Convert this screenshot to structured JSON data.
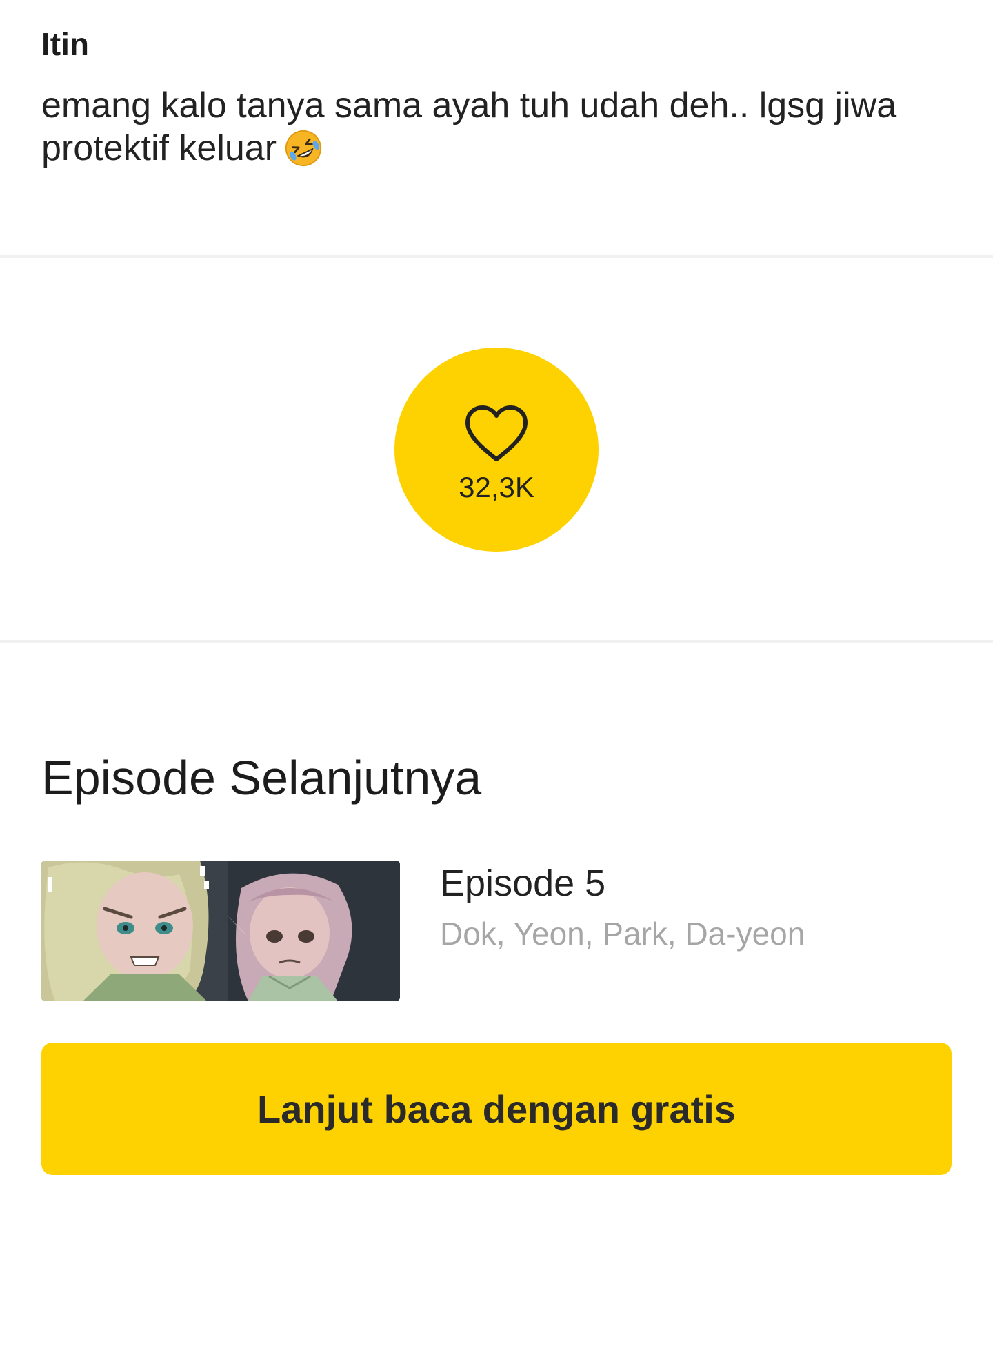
{
  "comment": {
    "author": "Itin",
    "text": "emang kalo tanya sama ayah tuh udah deh.. lgsg jiwa protektif keluar",
    "emoji": "rolling-on-floor-laughing-emoji"
  },
  "like": {
    "icon": "heart-icon",
    "count": "32,3K",
    "color": "#fdd200"
  },
  "next_episode": {
    "section_title": "Episode Selanjutnya",
    "title": "Episode 5",
    "authors": "Dok, Yeon, Park, Da-yeon"
  },
  "continue_button": {
    "label": "Lanjut baca dengan gratis",
    "color": "#fdd200"
  }
}
